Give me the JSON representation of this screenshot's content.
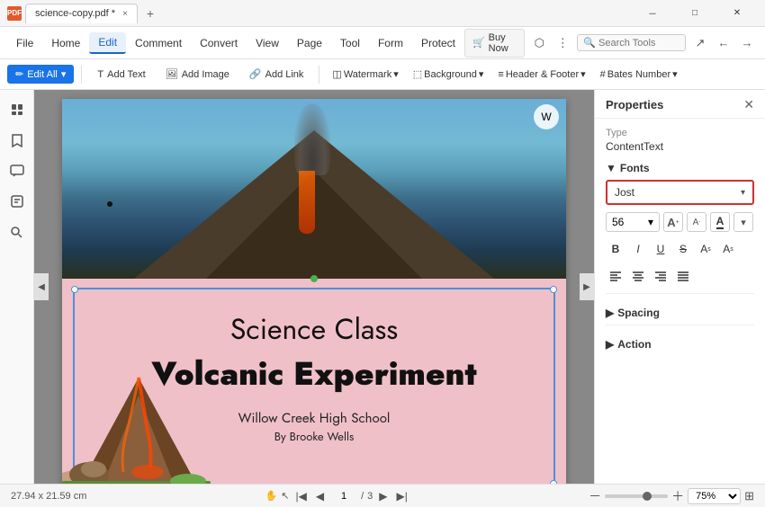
{
  "titleBar": {
    "fileName": "science-copy.pdf *",
    "closeTabLabel": "×",
    "newTabLabel": "+",
    "windowMinimize": "—",
    "windowMaximize": "□",
    "windowClose": "×"
  },
  "menuBar": {
    "file": "File",
    "home": "Home",
    "edit": "Edit",
    "comment": "Comment",
    "convert": "Convert",
    "view": "View",
    "page": "Page",
    "tool": "Tool",
    "form": "Form",
    "protect": "Protect",
    "searchPlaceholder": "Search Tools",
    "buyNow": "Buy Now"
  },
  "toolbar": {
    "editAll": "Edit All",
    "addText": "Add Text",
    "addImage": "Add Image",
    "addLink": "Add Link",
    "watermark": "Watermark",
    "background": "Background",
    "headerFooter": "Header & Footer",
    "batesNumber": "Bates Number"
  },
  "pdfPage": {
    "title1": "Science Class",
    "title2": "Volcanic Experiment",
    "sub1": "Willow Creek High School",
    "sub2": "By Brooke Wells"
  },
  "properties": {
    "panelTitle": "Properties",
    "typeLabel": "Type",
    "typeValue": "ContentText",
    "fontsLabel": "Fonts",
    "fontName": "Jost",
    "fontSize": "56",
    "spacingLabel": "Spacing",
    "actionLabel": "Action"
  },
  "statusBar": {
    "dimensions": "27.94 x 21.59 cm",
    "pageInfo": "1 / 3",
    "zoomLevel": "75%",
    "handTool": "✋",
    "selectTool": "↖"
  }
}
